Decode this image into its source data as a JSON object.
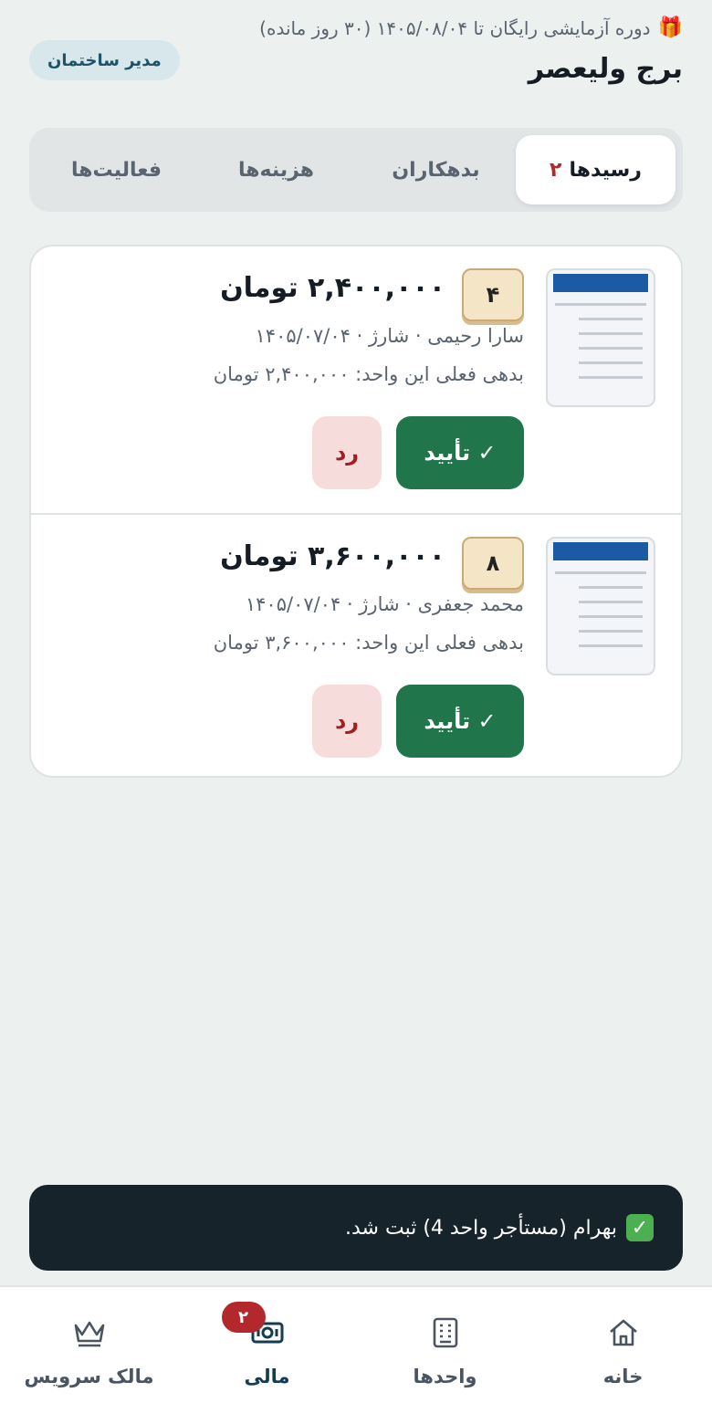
{
  "header": {
    "trial_text": "دوره آزمایشی رایگان تا ۱۴۰۵/۰۸/۰۴ (۳۰ روز مانده)",
    "gift_icon": "🎁",
    "title": "برج ولیعصر",
    "role_badge": "مدیر ساختمان"
  },
  "tabs": [
    {
      "label": "رسیدها",
      "count": "۲",
      "active": true
    },
    {
      "label": "بدهکاران"
    },
    {
      "label": "هزینه‌ها"
    },
    {
      "label": "فعالیت‌ها"
    }
  ],
  "receipts": [
    {
      "unit": "۴",
      "amount": "۲,۴۰۰,۰۰۰ تومان",
      "meta": "سارا رحیمی · شارژ · ۱۴۰۵/۰۷/۰۴",
      "debt": "بدهی فعلی این واحد: ۲,۴۰۰,۰۰۰ تومان",
      "approve_label": "✓ تأیید",
      "reject_label": "رد"
    },
    {
      "unit": "۸",
      "amount": "۳,۶۰۰,۰۰۰ تومان",
      "meta": "محمد جعفری · شارژ · ۱۴۰۵/۰۷/۰۴",
      "debt": "بدهی فعلی این واحد: ۳,۶۰۰,۰۰۰ تومان",
      "approve_label": "✓ تأیید",
      "reject_label": "رد"
    }
  ],
  "toast": {
    "icon": "✓",
    "message": "بهرام (مستأجر واحد 4) ثبت شد."
  },
  "bottom_nav": [
    {
      "label": "خانه",
      "icon": "home-icon"
    },
    {
      "label": "واحدها",
      "icon": "building-icon"
    },
    {
      "label": "مالی",
      "icon": "money-icon",
      "badge": "۲",
      "active": true
    },
    {
      "label": "مالک سرویس",
      "icon": "crown-icon"
    }
  ],
  "colors": {
    "background": "#ecf0ef",
    "approve": "#20764a",
    "reject_bg": "#f7dcdc",
    "reject_text": "#9f1f23",
    "badge_red": "#b3282d",
    "toast_bg": "#17232a"
  }
}
